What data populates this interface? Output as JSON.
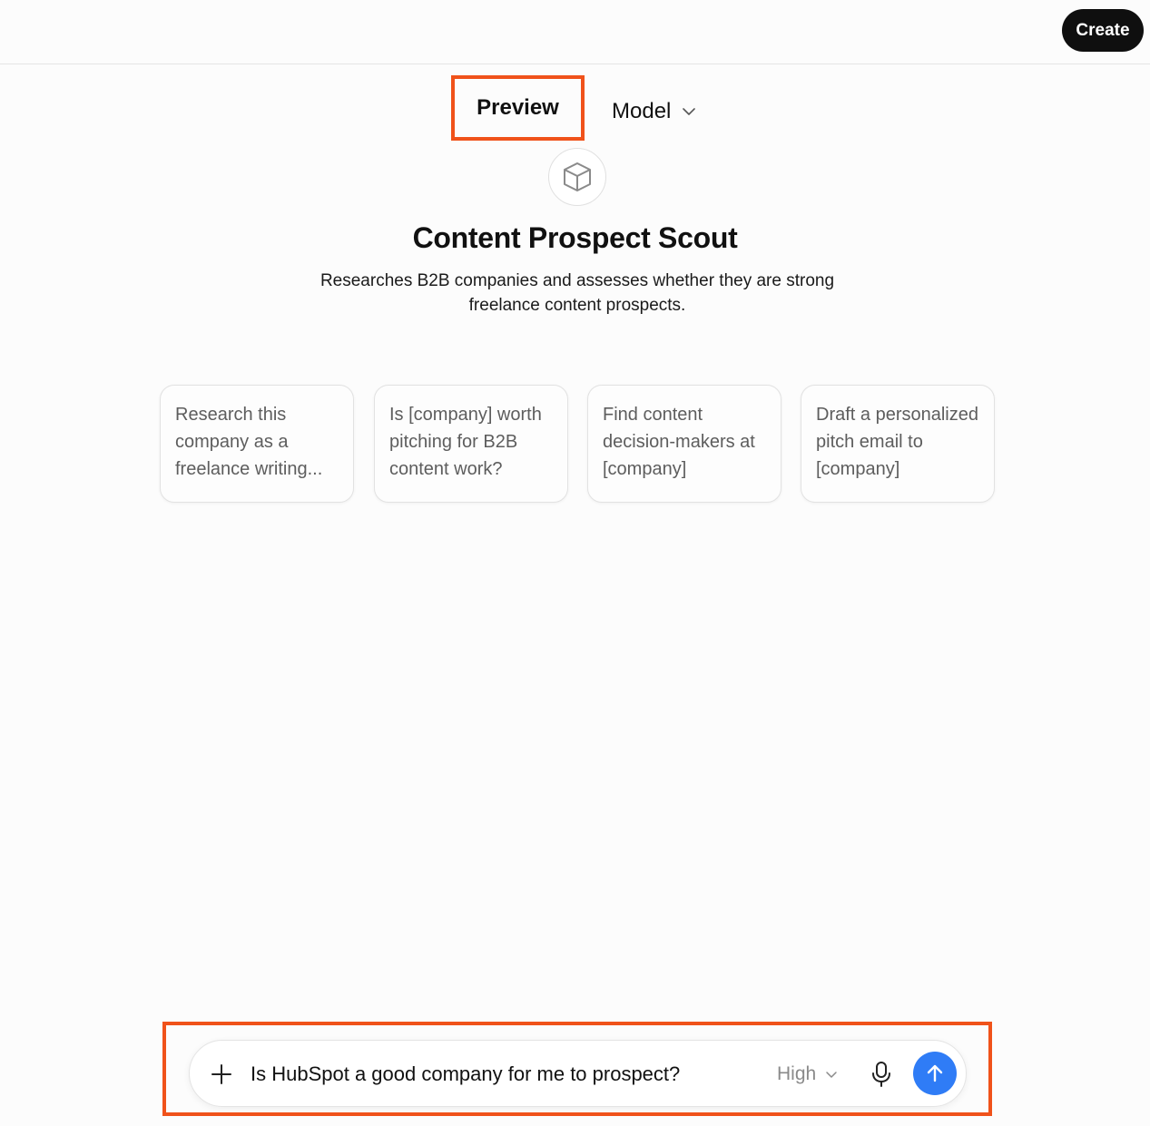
{
  "header": {
    "create_label": "Create"
  },
  "tabs": {
    "preview_label": "Preview",
    "model_label": "Model"
  },
  "assistant": {
    "icon": "cube-icon",
    "title": "Content Prospect Scout",
    "description": "Researches B2B companies and assesses whether they are strong freelance content prospects."
  },
  "suggestions": [
    {
      "label": "Research this company as a freelance writing..."
    },
    {
      "label": "Is [company] worth pitching for B2B content work?"
    },
    {
      "label": "Find content decision-makers at [company]"
    },
    {
      "label": "Draft a personalized pitch email to [company]"
    }
  ],
  "composer": {
    "value": "Is HubSpot a good company for me to prospect?",
    "effort_label": "High",
    "send_color": "#2f7cf6"
  },
  "colors": {
    "highlight": "#f0521a",
    "primary_button": "#0f0f0f"
  }
}
